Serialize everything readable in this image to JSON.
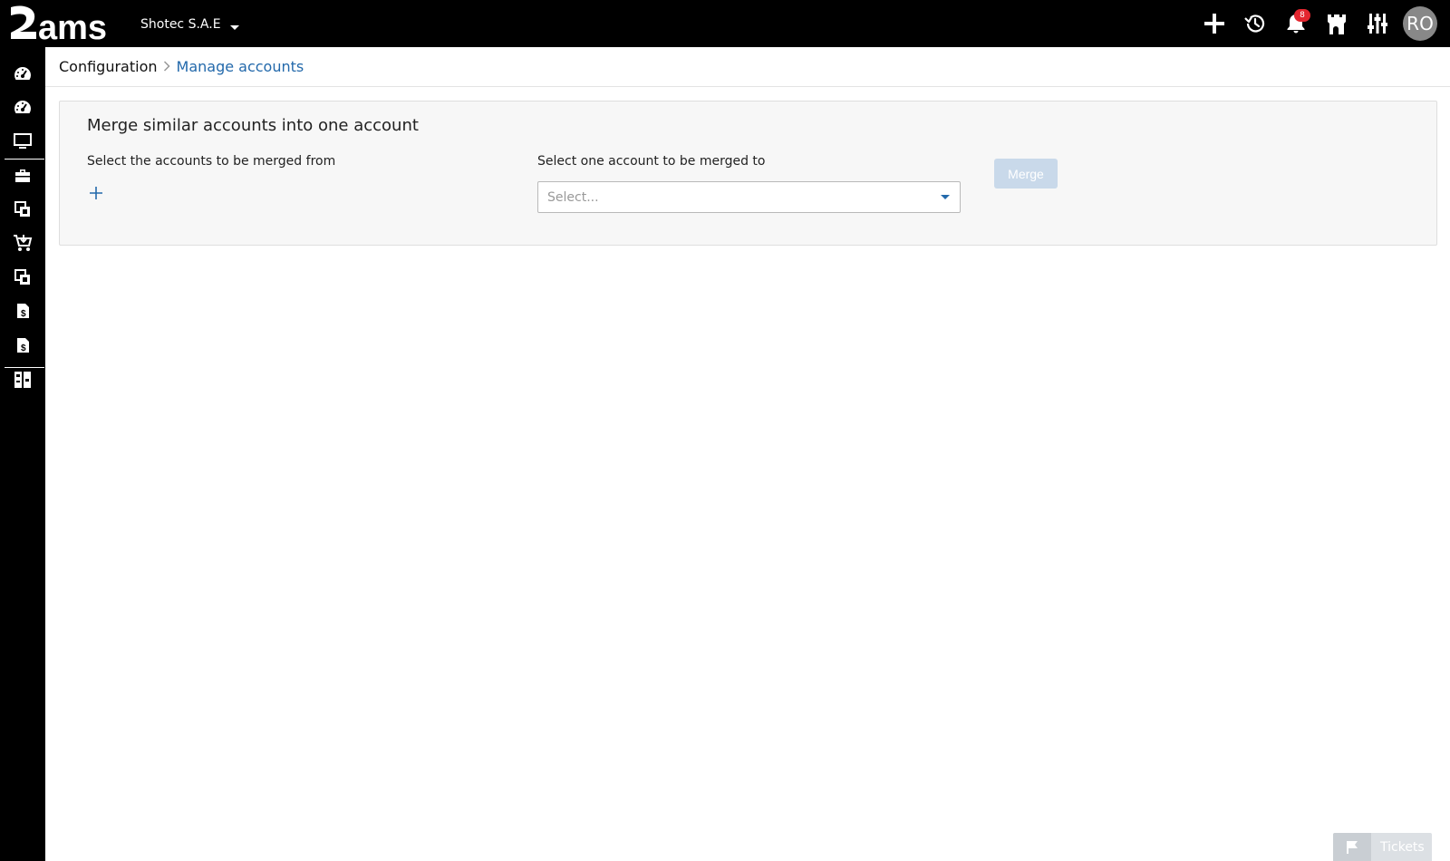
{
  "topbar": {
    "company": "Shotec S.A.E",
    "notification_count": "8",
    "avatar_initials": "RO",
    "icons": [
      "plus-icon",
      "history-icon",
      "bell-icon",
      "castle-icon",
      "sliders-icon"
    ]
  },
  "sidebar": {
    "icons": [
      "dashboard-icon",
      "dashboard-icon",
      "monitor-icon",
      "briefcase-icon",
      "documents-icon",
      "cart-icon",
      "documents-icon",
      "invoice-dollar-icon",
      "invoice-dollar-icon",
      "reports-icon"
    ]
  },
  "breadcrumb": {
    "parent": "Configuration",
    "current": "Manage accounts"
  },
  "panel": {
    "title": "Merge similar accounts into one account",
    "from_label": "Select the accounts to be merged from",
    "to_label": "Select one account to be merged to",
    "select_placeholder": "Select...",
    "merge_label": "Merge"
  },
  "tickets": {
    "label": "Tickets"
  },
  "colors": {
    "accent": "#2369ab",
    "topbar_bg": "#000000",
    "badge": "#e3262f",
    "merge_disabled_bg": "#c9d9ea"
  }
}
